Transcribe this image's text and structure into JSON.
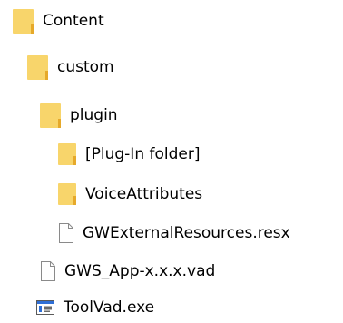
{
  "tree": {
    "items": [
      {
        "label": "Content",
        "icon": "folder-icon"
      },
      {
        "label": "custom",
        "icon": "folder-icon"
      },
      {
        "label": "plugin",
        "icon": "folder-icon"
      },
      {
        "label": "[Plug-In folder]",
        "icon": "folder-icon"
      },
      {
        "label": "VoiceAttributes",
        "icon": "folder-icon"
      },
      {
        "label": "GWExternalResources.resx",
        "icon": "file-icon"
      },
      {
        "label": "GWS_App-x.x.x.vad",
        "icon": "file-icon"
      },
      {
        "label": "ToolVad.exe",
        "icon": "exe-icon"
      }
    ]
  },
  "colors": {
    "folder": "#f8d56b",
    "folder_edge": "#e6a92a",
    "exe_accent": "#2f6fd6"
  }
}
